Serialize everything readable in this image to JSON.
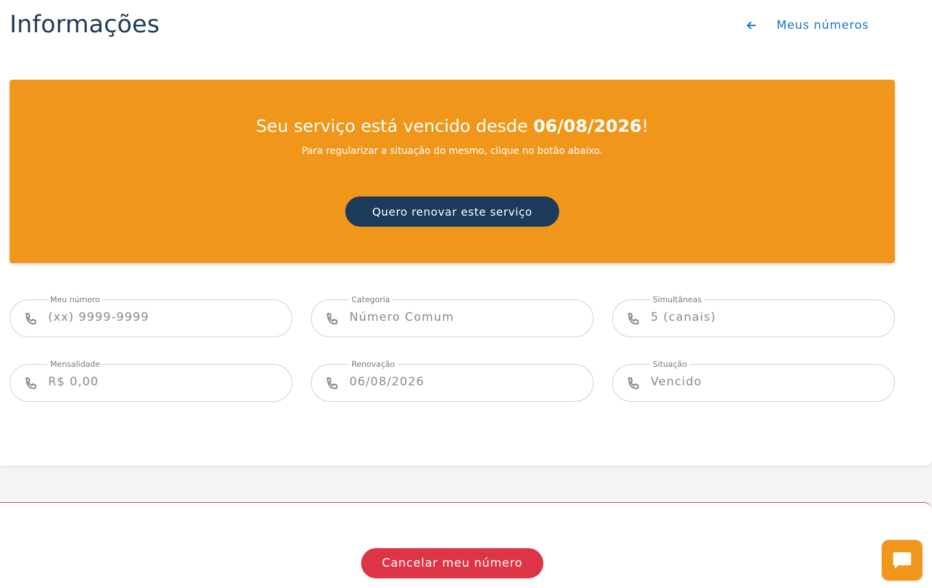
{
  "header": {
    "title": "Informações",
    "back_link_label": "Meus números",
    "back_icon": "arrow-left-icon"
  },
  "banner": {
    "title_prefix": "Seu serviço está vencido desde ",
    "title_date": "06/08/2026",
    "title_suffix": "!",
    "subtitle": "Para regularizar a situação do mesmo, clique no botão abaixo.",
    "renew_button_label": "Quero renovar este serviço",
    "color": "#f0971b"
  },
  "fields": [
    {
      "label": "Meu número",
      "value": "(xx) 9999-9999",
      "icon": "phone-icon"
    },
    {
      "label": "Categoria",
      "value": "Número Comum",
      "icon": "phone-icon"
    },
    {
      "label": "Simultâneas",
      "value": "5 (canais)",
      "icon": "phone-icon"
    },
    {
      "label": "Mensalidade",
      "value": "R$ 0,00",
      "icon": "phone-icon"
    },
    {
      "label": "Renovação",
      "value": "06/08/2026",
      "icon": "phone-icon"
    },
    {
      "label": "Situação",
      "value": "Vencido",
      "icon": "phone-icon"
    }
  ],
  "footer": {
    "cancel_button_label": "Cancelar meu número",
    "chat_icon": "chat-icon"
  },
  "colors": {
    "primary_dark": "#1b3a5c",
    "accent_orange": "#f0971b",
    "danger_red": "#dd3545",
    "link_blue": "#1a6fd6"
  }
}
